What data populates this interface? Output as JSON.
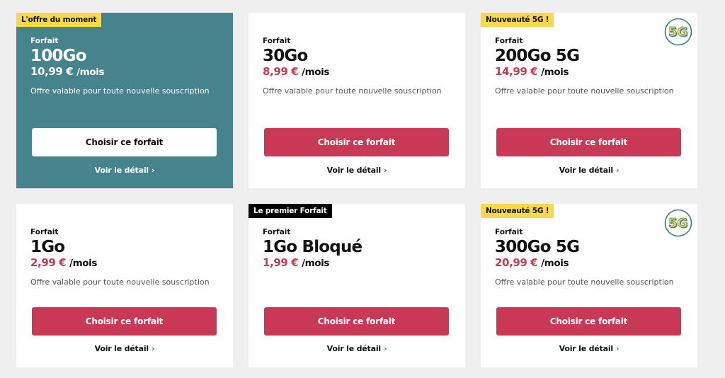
{
  "cards": [
    {
      "badge": "L'offre du moment",
      "kind": "Forfait",
      "plan": "100Go",
      "price": "10,99 €",
      "per": "/mois",
      "note": "Offre valable pour toute nouvelle souscription",
      "cta": "Choisir ce forfait",
      "detail": "Voir le détail",
      "chevron": "›"
    },
    {
      "kind": "Forfait",
      "plan": "30Go",
      "price": "8,99 €",
      "per": "/mois",
      "note": "Offre valable pour toute nouvelle souscription",
      "cta": "Choisir ce forfait",
      "detail": "Voir le détail",
      "chevron": "›"
    },
    {
      "badge": "Nouveauté 5G !",
      "kind": "Forfait",
      "plan": "200Go 5G",
      "price": "14,99 €",
      "per": "/mois",
      "note": "Offre valable pour toute nouvelle souscription",
      "cta": "Choisir ce forfait",
      "detail": "Voir le détail",
      "chevron": "›",
      "logo": "5G"
    },
    {
      "kind": "Forfait",
      "plan": "1Go",
      "price": "2,99 €",
      "per": "/mois",
      "note": "Offre valable pour toute nouvelle souscription",
      "cta": "Choisir ce forfait",
      "detail": "Voir le détail",
      "chevron": "›"
    },
    {
      "badge": "Le premier Forfait",
      "kind": "Forfait",
      "plan": "1Go Bloqué",
      "price": "1,99 €",
      "per": "/mois",
      "cta": "Choisir ce forfait",
      "detail": "Voir le détail",
      "chevron": "›"
    },
    {
      "badge": "Nouveauté 5G !",
      "kind": "Forfait",
      "plan": "300Go 5G",
      "price": "20,99 €",
      "per": "/mois",
      "note": "Offre valable pour toute nouvelle souscription",
      "cta": "Choisir ce forfait",
      "detail": "Voir le détail",
      "chevron": "›",
      "logo": "5G"
    }
  ],
  "colors": {
    "background": "#efefef",
    "featured_card": "#45838d",
    "accent": "#c93956",
    "badge_yellow": "#f9d84a",
    "badge_black": "#000000",
    "logo_circle": "#3a7d8a"
  },
  "icons": {
    "logo": "5g-logo-icon",
    "chevron": "chevron-right-icon"
  }
}
